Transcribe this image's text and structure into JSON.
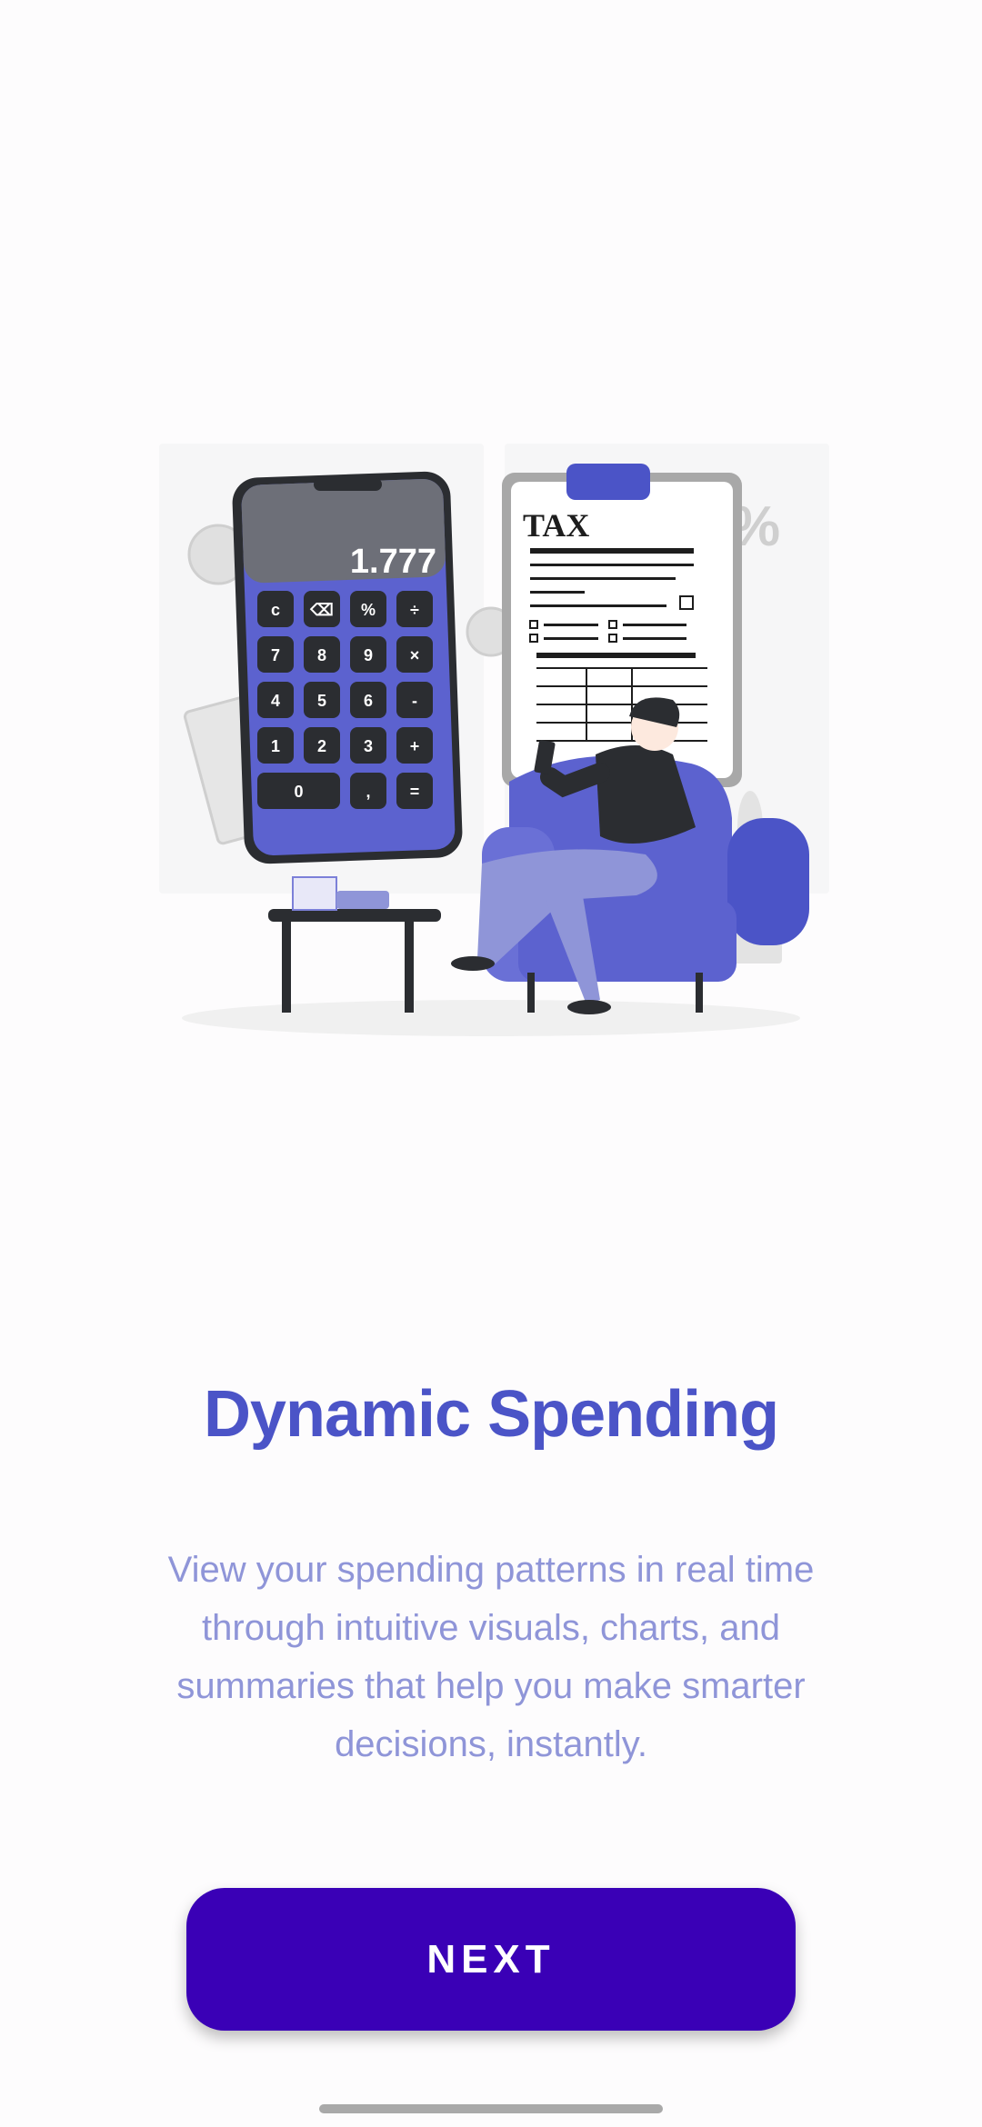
{
  "illustration": {
    "icon": "calculator-tax-person-illustration",
    "calculator_display": "1.777",
    "calculator_keys": [
      "c",
      "⌫",
      "%",
      "÷",
      "7",
      "8",
      "9",
      "×",
      "4",
      "5",
      "6",
      "-",
      "1",
      "2",
      "3",
      "+",
      "0",
      ",",
      "="
    ],
    "document_label": "TAX",
    "percent_sign": "%",
    "colors": {
      "accent": "#4b54c7",
      "dark": "#2b2d31",
      "light_purple": "#8f95d8"
    }
  },
  "onboarding": {
    "title": "Dynamic Spending",
    "description": "View your spending patterns in real time through intuitive visuals, charts, and summaries that help you make smarter decisions, instantly.",
    "next_label": "NEXT"
  },
  "colors": {
    "title": "#4b54c7",
    "description": "#8f95d8",
    "button": "#3a00b6"
  }
}
